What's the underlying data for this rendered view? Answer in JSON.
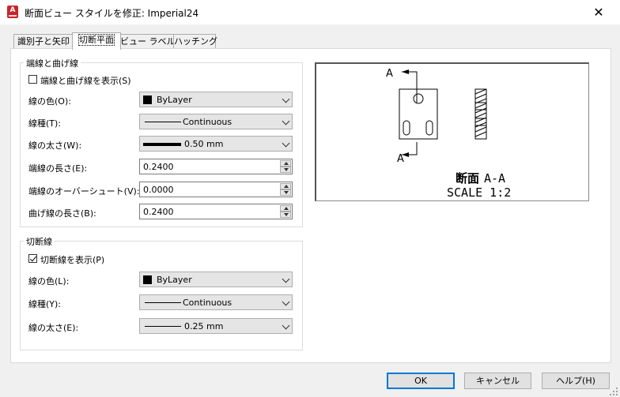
{
  "window": {
    "title": "断面ビュー スタイルを修正: Imperial24",
    "app_icon_letter": "A",
    "close_glyph": "✕"
  },
  "tabs": [
    {
      "label": "識別子と矢印",
      "active": false
    },
    {
      "label": "切断平面",
      "active": true
    },
    {
      "label": "ビュー ラベル",
      "active": false
    },
    {
      "label": "ハッチング",
      "active": false
    }
  ],
  "end_bend_lines": {
    "group_label": "端線と曲げ線",
    "show_checkbox_label": "端線と曲げ線を表示(S)",
    "show_checked": false,
    "color_label": "線の色(O):",
    "color_value": "ByLayer",
    "linetype_label": "線種(T):",
    "linetype_value": "Continuous",
    "lineweight_label": "線の太さ(W):",
    "lineweight_value": "0.50 mm",
    "end_length_label": "端線の長さ(E):",
    "end_length_value": "0.2400",
    "overshoot_label": "端線のオーバーシュート(V):",
    "overshoot_value": "0.0000",
    "bend_length_label": "曲げ線の長さ(B):",
    "bend_length_value": "0.2400"
  },
  "cutting_plane_lines": {
    "group_label": "切断線",
    "show_checkbox_label": "切断線を表示(P)",
    "show_checked": true,
    "color_label": "線の色(L):",
    "color_value": "ByLayer",
    "linetype_label": "線種(Y):",
    "linetype_value": "Continuous",
    "lineweight_label": "線の太さ(E):",
    "lineweight_value": "0.25 mm"
  },
  "preview": {
    "label_top": "A",
    "label_bottom": "A",
    "caption_bold": "断面",
    "caption_id": "A-A",
    "scale_text": "SCALE 1:2"
  },
  "buttons": {
    "ok": "OK",
    "cancel": "キャンセル",
    "help": "ヘルプ(H)"
  },
  "colors": {
    "accent": "#0078d7",
    "app_icon": "#c8242b",
    "swatch": "#000000"
  }
}
